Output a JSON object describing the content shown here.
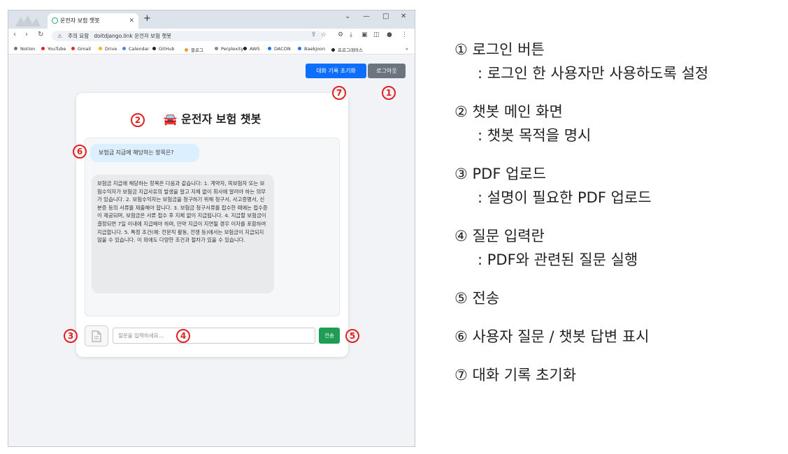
{
  "browser": {
    "tab_title": "운전자 보험 챗봇",
    "url_warning": "주의 요함",
    "url": "doitdjango.link 운전자 보험 챗봇",
    "bookmarks": [
      {
        "label": "Notion",
        "color": "#777777"
      },
      {
        "label": "YouTube",
        "color": "#e62117"
      },
      {
        "label": "Gmail",
        "color": "#d93025"
      },
      {
        "label": "Drive",
        "color": "#f4b400"
      },
      {
        "label": "Calendar",
        "color": "#4285f4"
      },
      {
        "label": "GitHub",
        "color": "#222222"
      },
      {
        "label": "블로그",
        "color": "#e0a030"
      },
      {
        "label": "Perplexity",
        "color": "#888888"
      },
      {
        "label": "AWS",
        "color": "#222222"
      },
      {
        "label": "DACON",
        "color": "#1a73e8"
      },
      {
        "label": "Baekjoon",
        "color": "#1a73e8"
      },
      {
        "label": "프로그래머스",
        "color": "#222222"
      }
    ]
  },
  "page": {
    "reset_button": "대화 기록 초기화",
    "logout_button": "로그아웃",
    "title": "🚘 운전자 보험 챗봇",
    "user_message": "보험금 지급에 해당하는 항목은?",
    "bot_message": "보험금 지급에 해당하는 항목은 다음과 같습니다: 1. 계약자, 피보험자 또는 보험수익자가 보험금 지급사유의 발생을 알고 지체 없이 회사에 알려야 하는 의무가 있습니다. 2. 보험수익자는 보험금을 청구하기 위해 청구서, 사고증명서, 신분증 등의 서류를 제출해야 합니다. 3. 보험금 청구서류를 접수한 때에는 접수증이 제공되며, 보험금은 서류 접수 후 지체 없이 지급됩니다. 4. 지급할 보험금이 결정되면 7일 이내에 지급해야 하며, 만약 지급이 지연될 경우 이자를 포함하여 지급합니다. 5. 특정 조건(예: 전문직 활동, 전쟁 등)에서는 보험금이 지급되지 않을 수 있습니다. 이 외에도 다양한 조건과 절차가 있을 수 있습니다.",
    "input_placeholder": "질문을 입력하세요...",
    "send_button": "전송"
  },
  "markers": [
    "①",
    "②",
    "③",
    "④",
    "⑤",
    "⑥",
    "⑦"
  ],
  "marker_numbers": [
    "1",
    "2",
    "3",
    "4",
    "5",
    "6",
    "7"
  ],
  "legend": [
    {
      "title": "① 로그인 버튼",
      "desc": ": 로그인 한 사용자만 사용하도록 설정"
    },
    {
      "title": "② 챗봇 메인 화면",
      "desc": ": 챗봇 목적을 명시"
    },
    {
      "title": "③ PDF 업로드",
      "desc": ": 설명이 필요한 PDF 업로드"
    },
    {
      "title": "④ 질문 입력란",
      "desc": ": PDF와 관련된 질문 실행"
    },
    {
      "title": "⑤ 전송",
      "desc": ""
    },
    {
      "title": "⑥ 사용자 질문 / 챗봇 답변 표시",
      "desc": ""
    },
    {
      "title": "⑦ 대화 기록 초기화",
      "desc": ""
    }
  ]
}
